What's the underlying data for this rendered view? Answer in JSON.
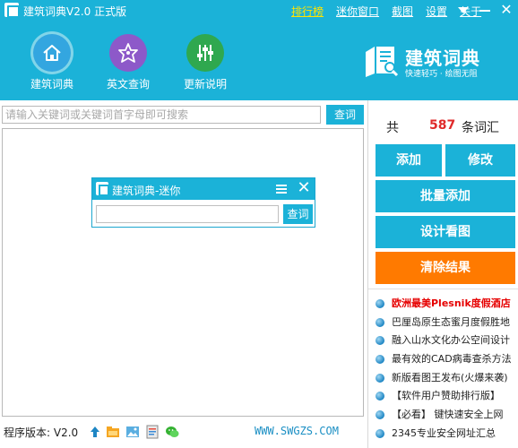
{
  "window": {
    "title": "建筑词典V2.0 正式版",
    "menu": [
      "排行榜",
      "迷你窗口",
      "截图",
      "设置",
      "关于"
    ]
  },
  "nav": [
    {
      "label": "建筑词典",
      "icon": "home-icon"
    },
    {
      "label": "英文查询",
      "icon": "english-star-icon"
    },
    {
      "label": "更新说明",
      "icon": "sliders-icon"
    }
  ],
  "logo": {
    "name": "建筑词典",
    "slogan": "快速轻巧 · 绘图无阻"
  },
  "search": {
    "placeholder": "请输入关键词或关键词首字母即可搜索",
    "value": "",
    "button": "查词"
  },
  "mini_window": {
    "title": "建筑词典-迷你",
    "input_value": "",
    "button": "查词"
  },
  "counter": {
    "prefix": "共",
    "count": "587",
    "suffix": "条词汇"
  },
  "actions": {
    "add": "添加",
    "edit": "修改",
    "batch_add": "批量添加",
    "design": "设计看图",
    "clear": "清除结果"
  },
  "news": [
    "欧洲最美Plesnik度假酒店",
    "巴厘岛原生态蜜月度假胜地",
    "融入山水文化办公空间设计",
    "最有效的CAD病毒查杀方法",
    "新版看图王发布(火爆来袭)",
    "【软件用户赞助排行版】",
    "【必看】 键快速安全上网",
    "2345专业安全网址汇总"
  ],
  "status": {
    "version": "程序版本: V2.0",
    "site": "WWW.SWGZS.COM"
  },
  "colors": {
    "brand": "#1bb2d8",
    "clear": "#ff7a00",
    "count": "#e02a2a",
    "hot_link": "#ffe400"
  }
}
